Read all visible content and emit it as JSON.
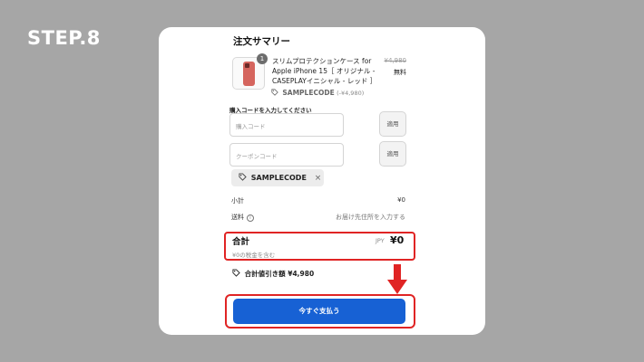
{
  "step_label": "STEP.8",
  "summary": {
    "title": "注文サマリー",
    "item": {
      "quantity": "1",
      "name": "スリムプロテクションケース for Apple iPhone 15［ オリジナル - CASEPLAYイニシャル - レッド ］",
      "original_price": "¥4,980",
      "price": "無料",
      "applied_code": "SAMPLECODE",
      "discount": "(-¥4,980)"
    }
  },
  "code_section": {
    "label": "購入コードを入力してください",
    "purchase_placeholder": "購入コード",
    "coupon_placeholder": "クーポンコード",
    "apply_label": "適用"
  },
  "applied_chip": {
    "code": "SAMPLECODE",
    "remove": "×"
  },
  "subtotal": {
    "label": "小計",
    "value": "¥0"
  },
  "shipping": {
    "label": "送料",
    "info": "i",
    "value": "お届け先住所を入力する"
  },
  "total": {
    "label": "合計",
    "currency": "JPY",
    "value": "¥0",
    "tax_note": "¥0の税金を含む"
  },
  "savings": {
    "label": "合計値引き額",
    "value": "¥4,980"
  },
  "pay_button": "今すぐ支払う",
  "colors": {
    "accent": "#1761d4",
    "highlight": "#e02424",
    "background": "#a6a6a6"
  }
}
